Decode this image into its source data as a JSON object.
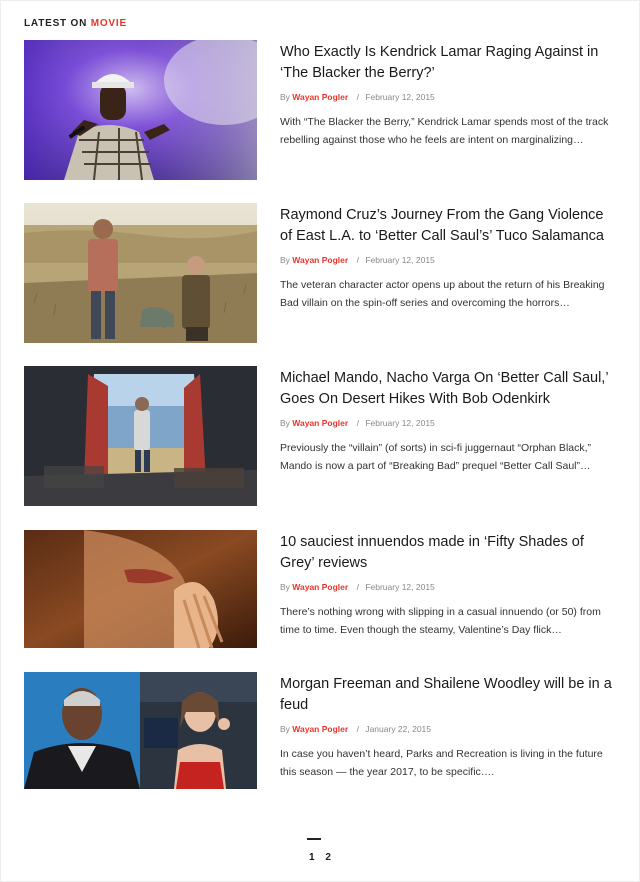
{
  "section": {
    "prefix": "LATEST ON",
    "category": "MOVIE"
  },
  "articles": [
    {
      "title": "Who Exactly Is Kendrick Lamar Raging Against in ‘The Blacker the Berry?’",
      "by": "By",
      "author": "Wayan Pogler",
      "sep": "/",
      "date": "February 12, 2015",
      "excerpt": "With “The Blacker the Berry,” Kendrick Lamar spends most of the track rebelling against those who he feels are intent on marginalizing…"
    },
    {
      "title": "Raymond Cruz’s Journey From the Gang Violence of East L.A. to ‘Better Call Saul’s’ Tuco Salamanca",
      "by": "By",
      "author": "Wayan Pogler",
      "sep": "/",
      "date": "February 12, 2015",
      "excerpt": "The veteran character actor opens up about the return of his Breaking Bad villain on the spin-off series and overcoming the horrors…"
    },
    {
      "title": "Michael Mando, Nacho Varga On ‘Better Call Saul,’ Goes On Desert Hikes With Bob Odenkirk",
      "by": "By",
      "author": "Wayan Pogler",
      "sep": "/",
      "date": "February 12, 2015",
      "excerpt": "Previously the “villain” (of sorts) in sci-fi juggernaut “Orphan Black,” Mando is now a part of “Breaking Bad” prequel “Better Call Saul”…"
    },
    {
      "title": "10 sauciest innuendos made in ‘Fifty Shades of Grey’ reviews",
      "by": "By",
      "author": "Wayan Pogler",
      "sep": "/",
      "date": "February 12, 2015",
      "excerpt": "There’s nothing wrong with slipping in a casual innuendo (or 50) from time to time. Even though the steamy, Valentine’s Day flick…"
    },
    {
      "title": "Morgan Freeman and Shailene Woodley will be in a feud",
      "by": "By",
      "author": "Wayan Pogler",
      "sep": "/",
      "date": "January 22, 2015",
      "excerpt": "In case you haven’t heard, Parks and Recreation is living in the future this season — the year 2017, to be specific…."
    }
  ],
  "pagination": {
    "pages": [
      "1",
      "2"
    ],
    "current": "1"
  },
  "colors": {
    "accent": "#e8352b",
    "text": "#1a1a1a",
    "meta": "#888888"
  }
}
